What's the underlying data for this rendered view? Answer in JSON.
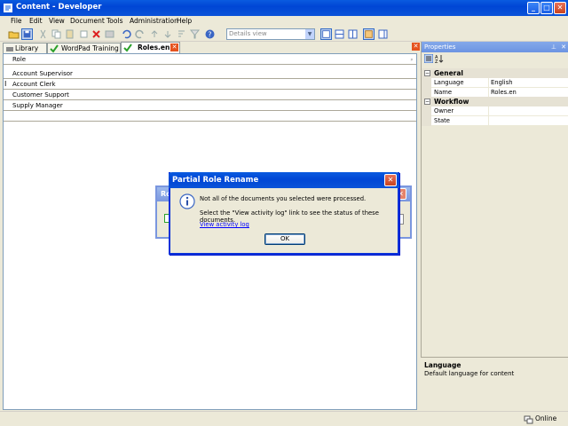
{
  "window": {
    "title": "Content - Developer"
  },
  "menu": [
    "File",
    "Edit",
    "View",
    "Document",
    "Tools",
    "Administration",
    "Help"
  ],
  "toolbar": {
    "view_select": "Details view"
  },
  "tabs": [
    {
      "label": "Library"
    },
    {
      "label": "WordPad Training"
    },
    {
      "label": "Roles.en"
    }
  ],
  "grid": {
    "column": "Role",
    "rows": [
      "Account Supervisor",
      "Account Clerk",
      "Customer Support",
      "Supply Manager"
    ]
  },
  "properties": {
    "title": "Properties",
    "categories": [
      {
        "name": "General",
        "rows": [
          {
            "key": "Language",
            "value": "English"
          },
          {
            "key": "Name",
            "value": "Roles.en"
          }
        ]
      },
      {
        "name": "Workflow",
        "rows": [
          {
            "key": "Owner",
            "value": ""
          },
          {
            "key": "State",
            "value": ""
          }
        ]
      }
    ],
    "description_title": "Language",
    "description_text": "Default language for content"
  },
  "status": {
    "text": "Online"
  },
  "background_dialog": {
    "title": "Ro"
  },
  "dialog": {
    "title": "Partial Role Rename",
    "line1": "Not all of the documents you selected were processed.",
    "line2": "Select the \"View activity log\" link to see the status of these documents.",
    "link": "View activity log",
    "ok": "OK"
  },
  "colors": {
    "titlebar": "#0A5BE0",
    "selection": "#316AC5",
    "link": "#0000FF"
  }
}
